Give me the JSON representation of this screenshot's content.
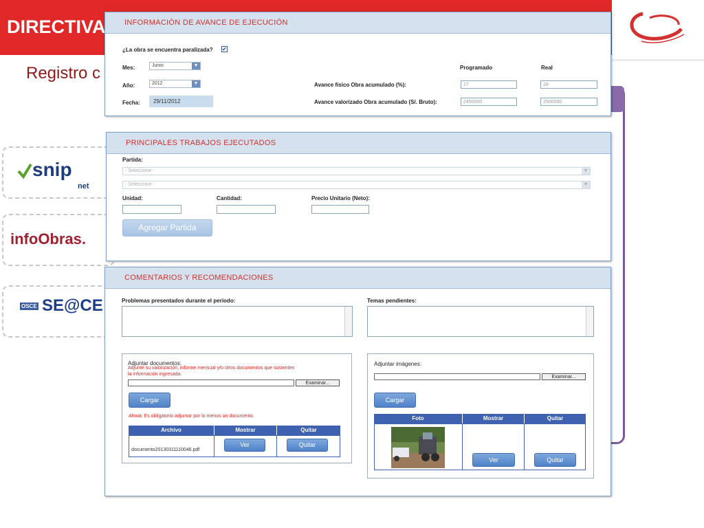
{
  "slide": {
    "title": "DIRECTIVA",
    "subtitle": "Registro c",
    "logos": {
      "snip": "snip",
      "snip_net": "net",
      "infoobras": "infoObras.",
      "seace": "SE@CE",
      "osce": "OSCE"
    }
  },
  "avance": {
    "title": "INFORMACIÓN DE AVANCE DE EJECUCIÓN",
    "paralizada_label": "¿La obra se encuentra paralizada?",
    "paralizada_checked": true,
    "mes_label": "Mes:",
    "mes_value": "Junio",
    "anio_label": "Año:",
    "anio_value": "2012",
    "fecha_label": "Fecha:",
    "fecha_value": "29/11/2012",
    "programado_header": "Programado",
    "real_header": "Real",
    "fisico_label": "Avance físico Obra acumulado (%):",
    "fisico_programado": "27",
    "fisico_real": "28",
    "valorizado_label": "Avance valorizado Obra acumulado (S/. Bruto):",
    "valorizado_programado": "2450000",
    "valorizado_real": "2500000"
  },
  "trabajos": {
    "title": "PRINCIPALES TRABAJOS EJECUTADOS",
    "partida_label": "Partida:",
    "select1": "- Seleccione -",
    "select2": "- Seleccione -",
    "unidad_label": "Unidad:",
    "cantidad_label": "Cantidad:",
    "precio_label": "Precio Unitario (Neto):",
    "agregar_button": "Agregar Partida"
  },
  "comentarios": {
    "title": "COMENTARIOS Y RECOMENDACIONES",
    "problemas_label": "Problemas presentados durante el período:",
    "temas_label": "Temas pendientes:",
    "docs": {
      "label": "Adjuntar documentos:",
      "hint_line1": "Adjunte su valorización, informe mensual y/o otros documentos que sustenten",
      "hint_line2": "la información ingresada.",
      "examinar": "Examinar...",
      "cargar": "Cargar",
      "warning": "Ahora: Es obligatorio adjuntar por lo menos un documento.",
      "columns": [
        "Archivo",
        "Mostrar",
        "Quitar"
      ],
      "rows": [
        {
          "archivo": "documento20130311110046.pdf",
          "ver": "Ver",
          "quitar": "Quitar"
        }
      ]
    },
    "images": {
      "label": "Adjuntar imágenes:",
      "examinar": "Examinar...",
      "cargar": "Cargar",
      "columns": [
        "Foto",
        "Mostrar",
        "Quitar"
      ],
      "rows": [
        {
          "ver": "Ver",
          "quitar": "Quitar"
        }
      ]
    }
  },
  "colors": {
    "banner_red": "#e02828",
    "panel_title_red": "#d4302a",
    "table_header_blue": "#3f62b0",
    "button_blue": "#4f82c8",
    "frame_purple": "#7a5a9a"
  }
}
